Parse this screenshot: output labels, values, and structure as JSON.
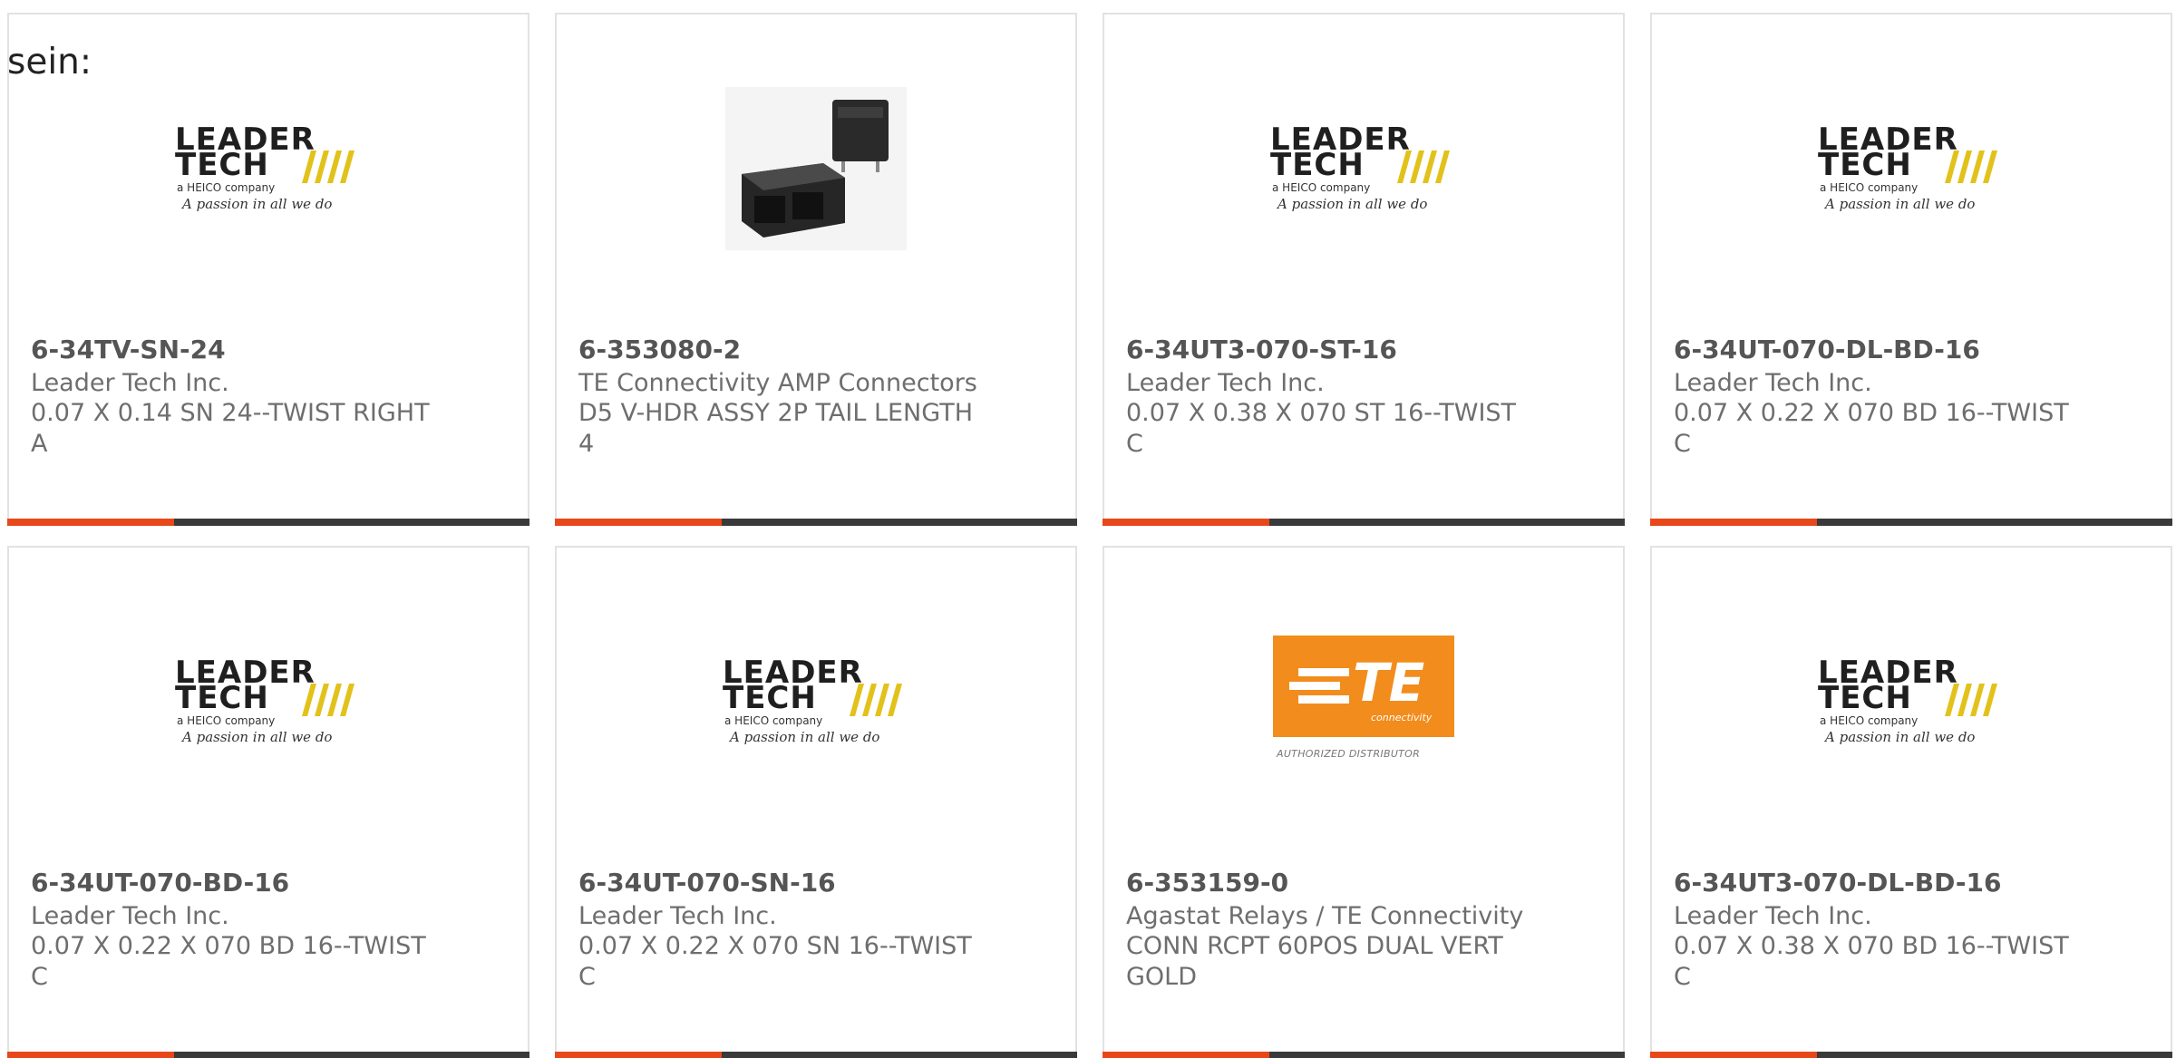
{
  "intro_text": "sein:",
  "colors": {
    "accent_bar": "#e8471a",
    "bar_dark": "#3a3a3a",
    "te_orange": "#f28c1c",
    "logo_yellow": "#e2c21a"
  },
  "logos": {
    "leadertech": {
      "line1": "LEADER",
      "line2": "TECH",
      "line3": "a HEICO company",
      "line4": "A passion in all we do"
    },
    "te": {
      "mark": "TE",
      "sub": "connectivity",
      "tag": "AUTHORIZED DISTRIBUTOR"
    }
  },
  "products": [
    {
      "part_number": "6-34TV-SN-24",
      "manufacturer": "Leader Tech Inc.",
      "description": "0.07 X 0.14 SN 24--TWIST RIGHT A",
      "image_icon": "leadertech-logo"
    },
    {
      "part_number": "6-353080-2",
      "manufacturer": "TE Connectivity AMP Connectors",
      "description": "D5 V-HDR ASSY 2P TAIL LENGTH 4",
      "image_icon": "connector-photo"
    },
    {
      "part_number": "6-34UT3-070-ST-16",
      "manufacturer": "Leader Tech Inc.",
      "description": "0.07 X 0.38 X 070 ST 16--TWIST C",
      "image_icon": "leadertech-logo"
    },
    {
      "part_number": "6-34UT-070-DL-BD-16",
      "manufacturer": "Leader Tech Inc.",
      "description": "0.07 X 0.22 X 070 BD 16--TWIST C",
      "image_icon": "leadertech-logo"
    },
    {
      "part_number": "6-34UT-070-BD-16",
      "manufacturer": "Leader Tech Inc.",
      "description": "0.07 X 0.22 X 070 BD 16--TWIST C",
      "image_icon": "leadertech-logo"
    },
    {
      "part_number": "6-34UT-070-SN-16",
      "manufacturer": "Leader Tech Inc.",
      "description": "0.07 X 0.22 X 070 SN 16--TWIST C",
      "image_icon": "leadertech-logo"
    },
    {
      "part_number": "6-353159-0",
      "manufacturer": "Agastat Relays / TE Connectivity",
      "description": "CONN RCPT 60POS DUAL VERT GOLD",
      "image_icon": "te-connectivity-logo"
    },
    {
      "part_number": "6-34UT3-070-DL-BD-16",
      "manufacturer": "Leader Tech Inc.",
      "description": "0.07 X 0.38 X 070 BD 16--TWIST C",
      "image_icon": "leadertech-logo"
    }
  ]
}
